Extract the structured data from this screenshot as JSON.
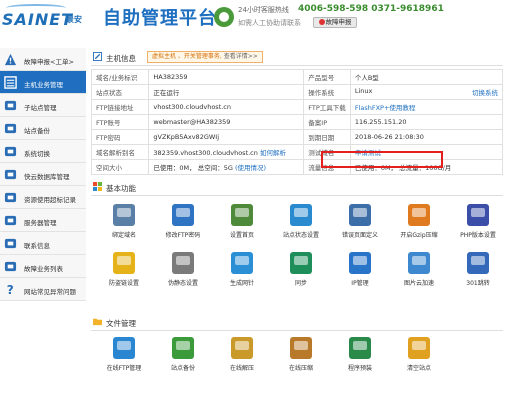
{
  "header": {
    "logo_text": "SAINET",
    "logo_cn": "景安",
    "title": "自助管理平台",
    "hotline_label": "24小时客服热线",
    "hotline_numbers": "4006-598-598  0371-9618961",
    "help_text": "如需人工协助请联系",
    "fault_button": "故障申报"
  },
  "sidebar": {
    "items": [
      {
        "label": "故障申报<工单>",
        "icon": "warning-icon",
        "active": false
      },
      {
        "label": "主机业务管理",
        "icon": "list-icon",
        "active": true
      },
      {
        "label": "子站点管理",
        "icon": "sitemap-icon",
        "active": false
      },
      {
        "label": "站点备份",
        "icon": "backup-icon",
        "active": false
      },
      {
        "label": "系统切换",
        "icon": "switch-icon",
        "active": false
      },
      {
        "label": "快云数据库管理",
        "icon": "database-icon",
        "active": false
      },
      {
        "label": "资源使用超标记录",
        "icon": "resource-icon",
        "active": false
      },
      {
        "label": "服务器管理",
        "icon": "lock-icon",
        "active": false
      },
      {
        "label": "联系信息",
        "icon": "phone-icon",
        "active": false
      },
      {
        "label": "故障业务列表",
        "icon": "report-icon",
        "active": false
      },
      {
        "label": "网站常见异常问题",
        "icon": "question-icon",
        "active": false
      }
    ]
  },
  "host_info": {
    "section_title": "主机信息",
    "notice": "虚拟主机 、开关管理事务,",
    "notice_link": "查看详情>>",
    "rows": [
      {
        "k1": "域名/业务标识",
        "v1": "HA382359",
        "k2": "产品型号",
        "v2": "个人B型",
        "v2_link": ""
      },
      {
        "k1": "站点状态",
        "v1": "正在运行",
        "k2": "操作系统",
        "v2": "Linux",
        "v2_link": "切换系统"
      },
      {
        "k1": "FTP链接地址",
        "v1": "vhost300.cloudvhost.cn",
        "k2": "FTP工具下载",
        "v2": "",
        "v2_link": "FlashFXP+使用教程"
      },
      {
        "k1": "FTP账号",
        "v1": "webmaster@HA382359",
        "k2": "备案IP",
        "v2": "116.255.151.20",
        "v2_link": ""
      },
      {
        "k1": "FTP密码",
        "v1": "gVZKpB5Axv82GWIj",
        "k2": "到期日期",
        "v2": "2018-06-26 21:08:30",
        "v2_link": ""
      },
      {
        "k1": "域名解析别名",
        "v1": "382359.vhost300.cloudvhost.cn",
        "v1_link": "如何解析",
        "k2": "测试域名",
        "v2": "",
        "v2_link": "申请测试"
      },
      {
        "k1": "空间大小",
        "v1": "已使用：0M， 总空间：5G",
        "v1_link": "(使用情况)",
        "k2": "流量信息",
        "v2": "已使用：0M， 总流量：100G/月",
        "v2_link": ""
      }
    ]
  },
  "basic_functions": {
    "section_title": "基本功能",
    "items": [
      {
        "label": "绑定域名",
        "icon": "bind-domain-icon",
        "color": "#5a7fa6"
      },
      {
        "label": "修改FTP密码",
        "icon": "lock-icon",
        "color": "#2f74c3"
      },
      {
        "label": "设置首页",
        "icon": "homepage-icon",
        "color": "#4f8a3a"
      },
      {
        "label": "站点状态设置",
        "icon": "globe-icon",
        "color": "#2a8ad0"
      },
      {
        "label": "错误页面定义",
        "icon": "error-page-icon",
        "color": "#3d6ea8"
      },
      {
        "label": "开启Gzip压缩",
        "icon": "gzip-icon",
        "color": "#e07a1f"
      },
      {
        "label": "PHP版本设置",
        "icon": "php-icon",
        "color": "#3b4fa8"
      },
      {
        "label": "防盗链设置",
        "icon": "shield-icon",
        "color": "#e5b21a"
      },
      {
        "label": "伪静态设置",
        "icon": "gear-icon",
        "color": "#7a7a7a"
      },
      {
        "label": "生成网针",
        "icon": "sitemap-gen-icon",
        "color": "#2b8fd6"
      },
      {
        "label": "同步",
        "icon": "sync-icon",
        "color": "#1e8f5a"
      },
      {
        "label": "IP管理",
        "icon": "ip-icon",
        "color": "#2874c9"
      },
      {
        "label": "图片云加速",
        "icon": "image-cloud-icon",
        "color": "#3d88cf"
      },
      {
        "label": "301跳转",
        "icon": "redirect-301-icon",
        "color": "#3468b8"
      }
    ]
  },
  "file_management": {
    "section_title": "文件管理",
    "items": [
      {
        "label": "在线FTP管理",
        "icon": "ftp-online-icon",
        "color": "#2b86d2"
      },
      {
        "label": "站点备份",
        "icon": "backup-icon",
        "color": "#3b9a3a"
      },
      {
        "label": "在线解压",
        "icon": "unzip-icon",
        "color": "#c99a2a"
      },
      {
        "label": "在线压缩",
        "icon": "zip-icon",
        "color": "#b87a2a"
      },
      {
        "label": "程序预装",
        "icon": "install-icon",
        "color": "#2a8a4a"
      },
      {
        "label": "清空站点",
        "icon": "clear-site-icon",
        "color": "#e0a020"
      }
    ]
  }
}
